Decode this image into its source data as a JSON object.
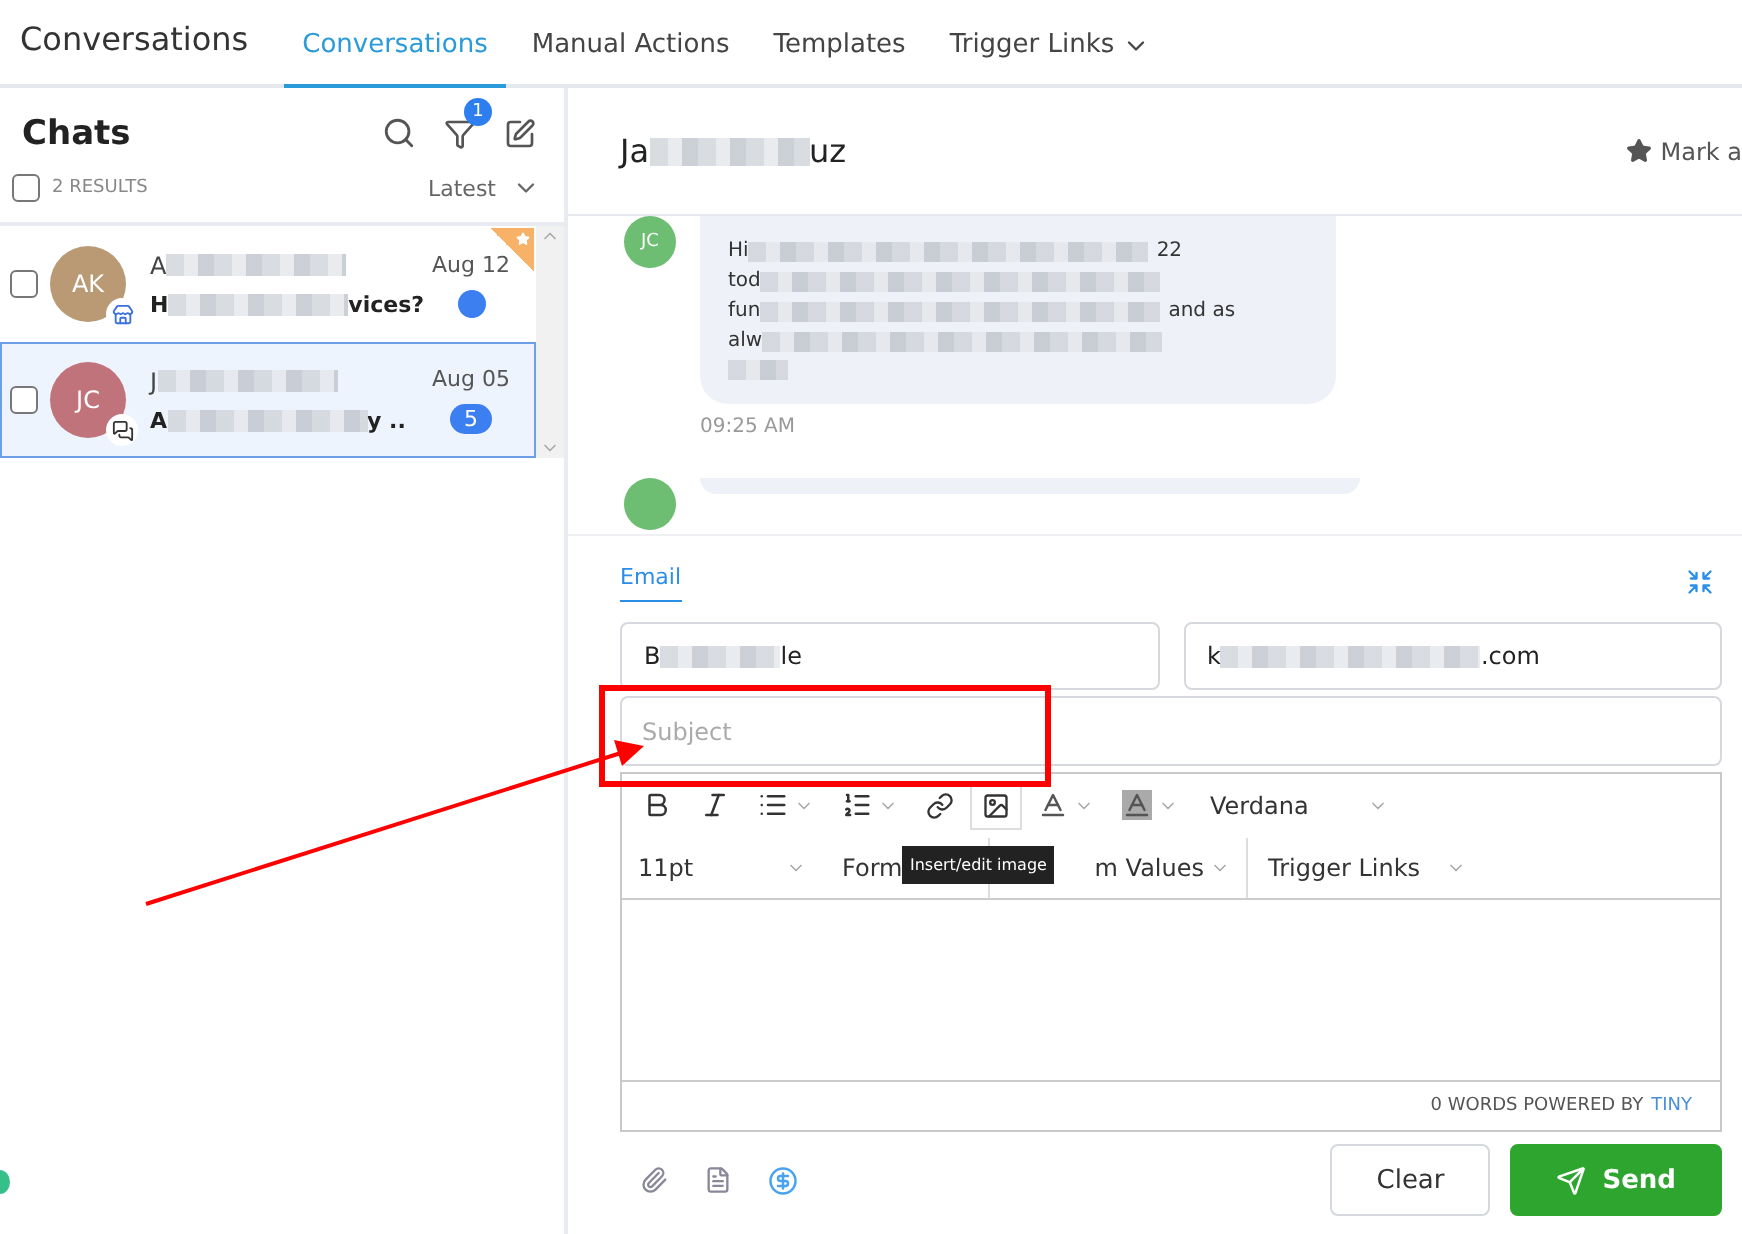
{
  "app_title": "Conversations",
  "nav_tabs": [
    {
      "label": "Conversations",
      "selected": true,
      "dropdown": false
    },
    {
      "label": "Manual Actions",
      "selected": false,
      "dropdown": false
    },
    {
      "label": "Templates",
      "selected": false,
      "dropdown": false
    },
    {
      "label": "Trigger Links",
      "selected": false,
      "dropdown": true
    }
  ],
  "sidebar": {
    "title": "Chats",
    "filter_badge": "1",
    "select_all_checked": false,
    "results": "2 RESULTS",
    "sort": "Latest",
    "conversations": [
      {
        "initials": "AK",
        "color": "#b99a74",
        "kind": "store",
        "name_start": "A",
        "preview_start": "H",
        "preview_end": "vices?",
        "date": "Aug 12",
        "starred": true,
        "selected": false,
        "checked": false
      },
      {
        "initials": "JC",
        "color": "#c0737b",
        "kind": "chat",
        "name_start": "J",
        "preview_start": "A",
        "preview_end": "y ..",
        "date": "Aug 05",
        "unread": "5",
        "starred": false,
        "selected": true,
        "checked": false
      }
    ]
  },
  "conversation": {
    "name_start": "Ja",
    "name_end": "uz",
    "mark_action": "Mark a",
    "messages": [
      {
        "initials": "JC",
        "lines": [
          {
            "start": "Hi",
            "end": "22"
          },
          {
            "start": "tod"
          },
          {
            "start": "fun",
            "end": "and as"
          },
          {
            "start": "alw"
          }
        ],
        "time": "09:25 AM"
      }
    ]
  },
  "composer": {
    "tabs": [
      {
        "label": "Email",
        "selected": true
      }
    ],
    "from_start": "B",
    "from_end": "le",
    "to_start": "k",
    "to_end": ".com",
    "subject": {
      "placeholder": "Subject"
    },
    "toolbar_font": "Verdana",
    "toolbar_size": "11pt",
    "formats_visible": "Form",
    "custom_values_visible": "m Values",
    "trigger_links": "Trigger Links",
    "tooltip": "Insert/edit image",
    "word_count": "0 WORDS POWERED BY",
    "powered_link": "TINY",
    "buttons": [
      {
        "label": "Clear",
        "kind": "secondary"
      },
      {
        "label": "Send",
        "kind": "primary"
      }
    ]
  }
}
